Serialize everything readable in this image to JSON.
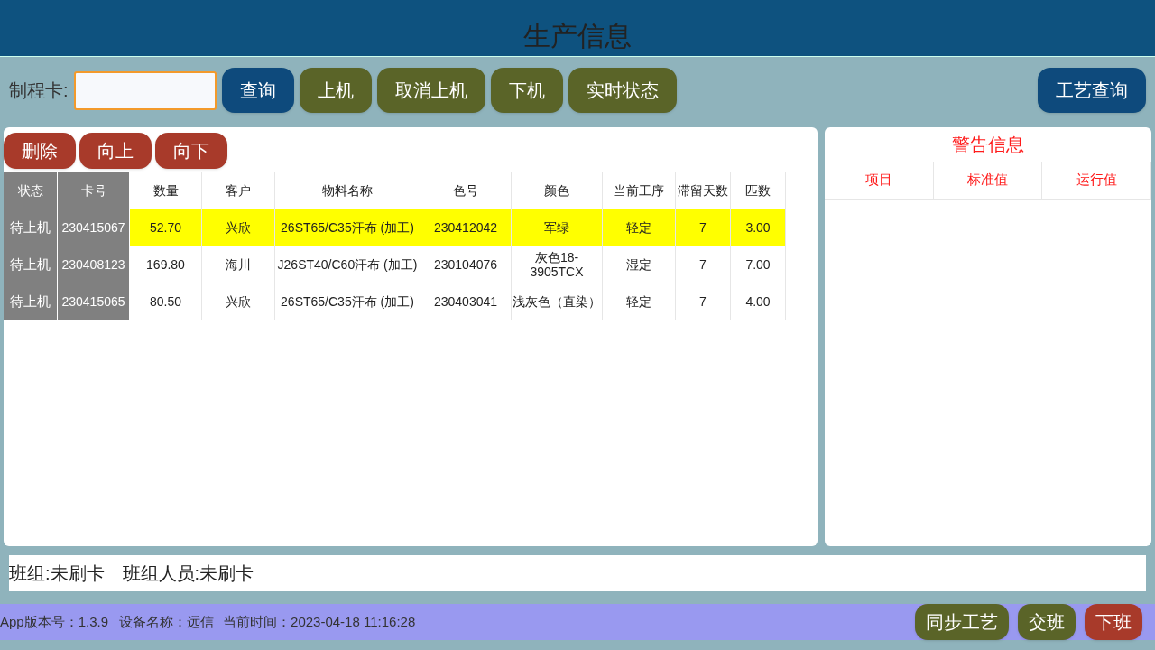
{
  "header": {
    "title": "生产信息"
  },
  "toolbar": {
    "card_label": "制程卡:",
    "buttons": [
      {
        "label": "查询",
        "kind": "blue"
      },
      {
        "label": "上机",
        "kind": "olive"
      },
      {
        "label": "取消上机",
        "kind": "olive"
      },
      {
        "label": "下机",
        "kind": "olive"
      },
      {
        "label": "实时状态",
        "kind": "olive"
      }
    ],
    "right_button": {
      "label": "工艺查询",
      "kind": "blue"
    }
  },
  "list_panel": {
    "buttons": [
      {
        "label": "删除",
        "kind": "red"
      },
      {
        "label": "向上",
        "kind": "red"
      },
      {
        "label": "向下",
        "kind": "red"
      }
    ],
    "table": {
      "columns": [
        "状态",
        "卡号",
        "数量",
        "客户",
        "物料名称",
        "色号",
        "颜色",
        "当前工序",
        "滞留天数",
        "匹数"
      ],
      "rows": [
        {
          "selected": true,
          "cells": [
            "待上机",
            "230415067",
            "52.70",
            "兴欣",
            "26ST65/C35汗布 (加工)",
            "230412042",
            "军绿",
            "轻定",
            "7",
            "3.00"
          ]
        },
        {
          "selected": false,
          "cells": [
            "待上机",
            "230408123",
            "169.80",
            "海川",
            "J26ST40/C60汗布 (加工)",
            "230104076",
            "灰色18-3905TCX",
            "湿定",
            "7",
            "7.00"
          ]
        },
        {
          "selected": false,
          "cells": [
            "待上机",
            "230415065",
            "80.50",
            "兴欣",
            "26ST65/C35汗布 (加工)",
            "230403041",
            "浅灰色（直染）",
            "轻定",
            "7",
            "4.00"
          ]
        }
      ]
    }
  },
  "warning_panel": {
    "title": "警告信息",
    "columns": [
      "项目",
      "标准值",
      "运行值"
    ]
  },
  "team_bar": {
    "team": "班组:未刷卡",
    "members": "班组人员:未刷卡"
  },
  "footer": {
    "version": "App版本号：1.3.9",
    "device": "设备名称：远信",
    "time": "当前时间：2023-04-18 11:16:28",
    "buttons": [
      {
        "label": "同步工艺",
        "kind": "olive"
      },
      {
        "label": "交班",
        "kind": "olive"
      },
      {
        "label": "下班",
        "kind": "red"
      }
    ]
  }
}
